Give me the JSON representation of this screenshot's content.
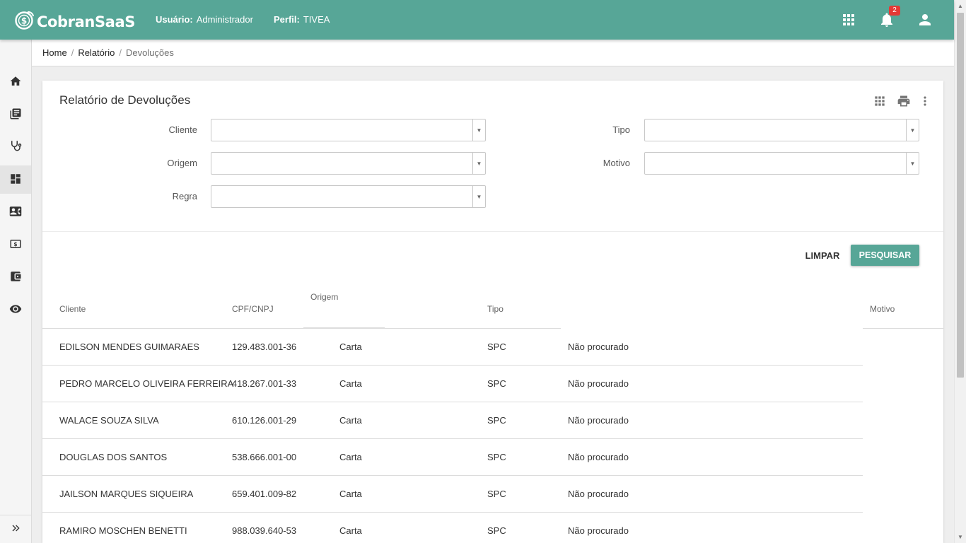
{
  "header": {
    "app_name": "CobranSaaS",
    "user_label": "Usuário:",
    "user_value": "Administrador",
    "profile_label": "Perfil:",
    "profile_value": "TIVEA",
    "notification_count": "2",
    "icons": [
      "apps-icon",
      "bell-icon",
      "account-icon"
    ],
    "color": "#57a697"
  },
  "sidebar": {
    "items": [
      {
        "icon": "home-icon"
      },
      {
        "icon": "library-books-icon"
      },
      {
        "icon": "stethoscope-icon"
      },
      {
        "icon": "dashboard-icon",
        "active": true
      },
      {
        "icon": "contact-card-icon"
      },
      {
        "icon": "money-icon"
      },
      {
        "icon": "wallet-icon"
      },
      {
        "icon": "eye-icon"
      }
    ],
    "expand_icon": "double-chevron-right-icon"
  },
  "breadcrumb": {
    "items": [
      "Home",
      "Relatório"
    ],
    "current": "Devoluções",
    "separator": "/"
  },
  "page": {
    "title": "Relatório de Devoluções",
    "tools": [
      "grid-icon",
      "print-icon",
      "more-vert-icon"
    ]
  },
  "filters": {
    "cliente": {
      "label": "Cliente",
      "value": ""
    },
    "tipo": {
      "label": "Tipo",
      "value": ""
    },
    "origem": {
      "label": "Origem",
      "value": ""
    },
    "motivo": {
      "label": "Motivo",
      "value": ""
    },
    "regra": {
      "label": "Regra",
      "value": ""
    }
  },
  "actions": {
    "clear_label": "LIMPAR",
    "search_label": "PESQUISAR"
  },
  "table": {
    "headers": {
      "cliente": "Cliente",
      "cpf": "CPF/CNPJ",
      "origem": "Origem",
      "tipo": "Tipo",
      "motivo": "Motivo"
    },
    "rows": [
      {
        "cliente": "EDILSON MENDES GUIMARAES",
        "cpf": "129.483.001-36",
        "origem": "Carta",
        "tipo": "SPC",
        "motivo": "Não procurado"
      },
      {
        "cliente": "PEDRO MARCELO OLIVEIRA FERREIRA",
        "cpf": "418.267.001-33",
        "origem": "Carta",
        "tipo": "SPC",
        "motivo": "Não procurado"
      },
      {
        "cliente": "WALACE SOUZA SILVA",
        "cpf": "610.126.001-29",
        "origem": "Carta",
        "tipo": "SPC",
        "motivo": "Não procurado"
      },
      {
        "cliente": "DOUGLAS DOS SANTOS",
        "cpf": "538.666.001-00",
        "origem": "Carta",
        "tipo": "SPC",
        "motivo": "Não procurado"
      },
      {
        "cliente": "JAILSON MARQUES SIQUEIRA",
        "cpf": "659.401.009-82",
        "origem": "Carta",
        "tipo": "SPC",
        "motivo": "Não procurado"
      },
      {
        "cliente": "RAMIRO MOSCHEN BENETTI",
        "cpf": "988.039.640-53",
        "origem": "Carta",
        "tipo": "SPC",
        "motivo": "Não procurado"
      }
    ]
  }
}
